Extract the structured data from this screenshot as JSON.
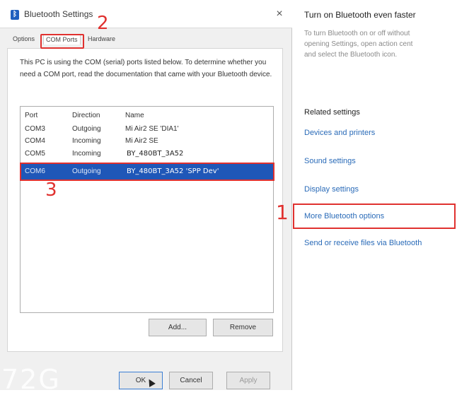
{
  "dialog": {
    "title": "Bluetooth Settings",
    "close_glyph": "×",
    "tabs": [
      {
        "label": "Options"
      },
      {
        "label": "COM Ports"
      },
      {
        "label": "Hardware"
      }
    ],
    "description": "This PC is using the COM (serial) ports listed below. To determine whether you need a COM port, read the documentation that came with your Bluetooth device.",
    "columns": {
      "port": "Port",
      "direction": "Direction",
      "name": "Name"
    },
    "rows": [
      {
        "port": "COM3",
        "direction": "Outgoing",
        "name": "Mi Air2 SE 'DIA1'"
      },
      {
        "port": "COM4",
        "direction": "Incoming",
        "name": "Mi Air2 SE"
      },
      {
        "port": "COM5",
        "direction": "Incoming",
        "name": "BY_480BT_3A52"
      },
      {
        "port": "COM6",
        "direction": "Outgoing",
        "name": "BY_480BT_3A52  'SPP Dev'"
      }
    ],
    "buttons": {
      "add": "Add...",
      "remove": "Remove",
      "ok": "OK",
      "cancel": "Cancel",
      "apply": "Apply"
    },
    "annotations": {
      "step1": "1",
      "step2": "2",
      "step3": "3"
    },
    "watermark": "72G",
    "icon": "bluetooth-icon",
    "highlight_color": "#e0312f",
    "selection_color": "#1f57b8"
  },
  "settings": {
    "title": "Turn on Bluetooth even faster",
    "subtitle_lines": [
      "To turn Bluetooth on or off without",
      "opening Settings, open action cent",
      "and select the Bluetooth icon."
    ],
    "related_heading": "Related settings",
    "links": [
      "Devices and printers",
      "Sound settings",
      "Display settings",
      "More Bluetooth options",
      "Send or receive files via Bluetooth"
    ],
    "link_color": "#2a6bb8"
  }
}
